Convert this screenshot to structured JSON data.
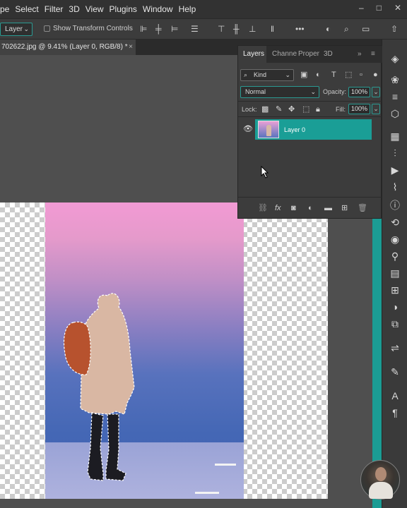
{
  "menubar": {
    "items": [
      "pe",
      "Select",
      "Filter",
      "3D",
      "View",
      "Plugins",
      "Window",
      "Help"
    ],
    "window_controls": [
      "–",
      "□",
      "✕"
    ]
  },
  "options": {
    "layer_select": "Layer",
    "show_transform_controls": "Show Transform Controls",
    "icons": [
      "align-left-icon",
      "align-center-h-icon",
      "align-right-icon",
      "distribute-icon",
      "align-top-icon",
      "align-middle-v-icon",
      "align-bottom-icon",
      "distribute-v-icon",
      "more-icon",
      "3d-mode-icon",
      "search-icon",
      "workspace-icon",
      "share-icon"
    ]
  },
  "document": {
    "tab_title": "702622.jpg @ 9.41% (Layer 0, RGB/8) *",
    "close": "×"
  },
  "layers_panel": {
    "tabs": [
      "Layers",
      "Channe",
      "Proper",
      "3D"
    ],
    "active_tab": "Layers",
    "kind_filter": "Kind",
    "blend_mode": "Normal",
    "opacity_label": "Opacity:",
    "opacity_value": "100%",
    "lock_label": "Lock:",
    "fill_label": "Fill:",
    "fill_value": "100%",
    "layers": [
      {
        "name": "Layer 0",
        "visible": true,
        "selected": true
      }
    ]
  },
  "colors": {
    "accent": "#1a9e96",
    "menubar_bg": "#323232",
    "panel_bg": "#3c3c3c"
  }
}
